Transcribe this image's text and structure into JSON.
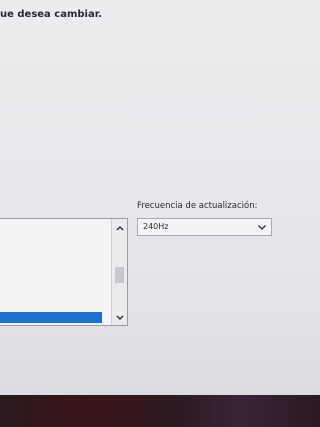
{
  "instruction": "ue desea cambiar.",
  "refresh_rate": {
    "label": "Frecuencia de actualización:",
    "value": "240Hz"
  },
  "icons": {
    "scroll_up": "chevron-up-icon",
    "scroll_down": "chevron-down-icon",
    "dropdown": "chevron-down-icon"
  },
  "colors": {
    "selection": "#1f6fd0"
  }
}
